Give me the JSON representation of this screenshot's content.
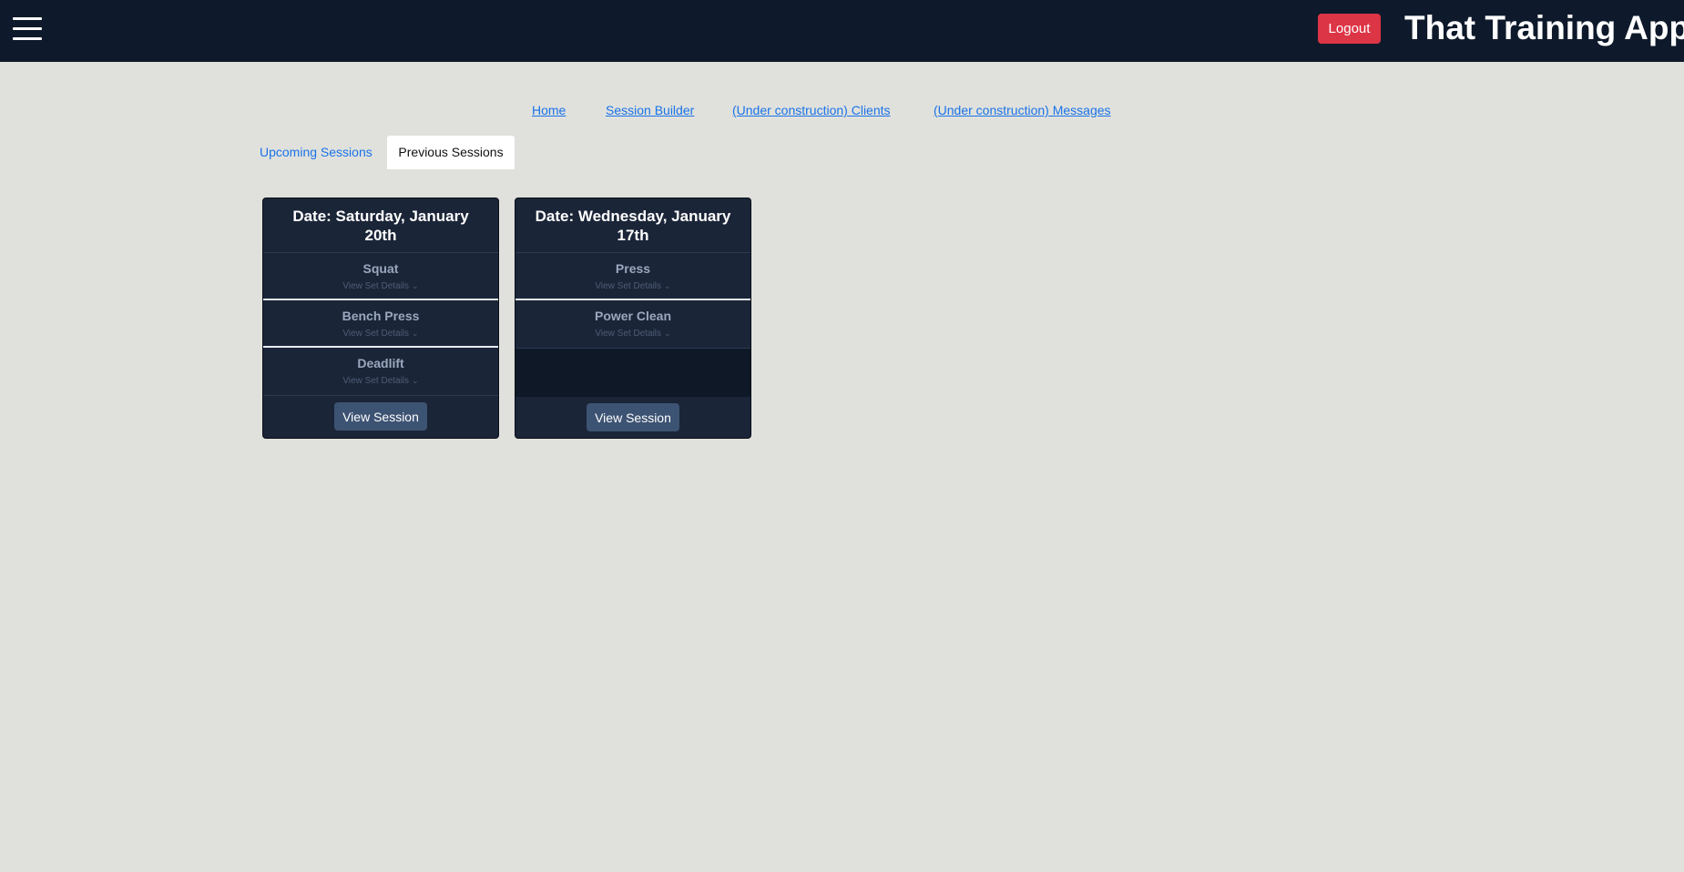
{
  "header": {
    "app_title": "That Training App",
    "logout_label": "Logout",
    "colors": {
      "bar": "#0e1a2b",
      "logout": "#dc3545"
    }
  },
  "nav": {
    "links": [
      {
        "label": "Home"
      },
      {
        "label": "Session Builder"
      },
      {
        "label": "(Under construction) Clients"
      },
      {
        "label": "(Under construction) Messages"
      }
    ]
  },
  "tabs": {
    "upcoming": "Upcoming Sessions",
    "previous": "Previous Sessions",
    "selected": "Previous Sessions"
  },
  "sessions": [
    {
      "date": "Date: Saturday, January 20th",
      "exercises": [
        {
          "name": "Squat",
          "details": "View Set Details"
        },
        {
          "name": "Bench Press",
          "details": "View Set Details"
        },
        {
          "name": "Deadlift",
          "details": "View Set Details"
        }
      ],
      "button": "View Session"
    },
    {
      "date": "Date: Wednesday, January 17th",
      "exercises": [
        {
          "name": "Press",
          "details": "View Set Details"
        },
        {
          "name": "Power Clean",
          "details": "View Set Details"
        }
      ],
      "button": "View Session"
    }
  ]
}
